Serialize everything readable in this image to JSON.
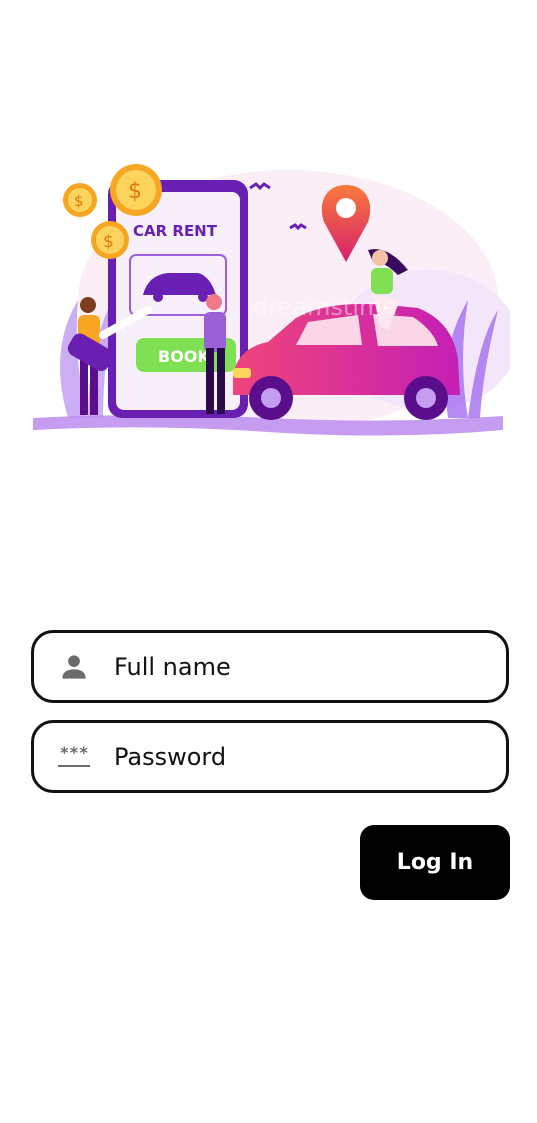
{
  "illustration": {
    "sign_text": "CAR RENT",
    "button_text": "BOOK",
    "coin_symbol": "$",
    "watermark": "dreamstime"
  },
  "form": {
    "name_placeholder": "Full name",
    "password_placeholder": "Password",
    "password_icon_text": "***",
    "login_label": "Log In"
  },
  "icons": {
    "name": "person-icon",
    "password": "password-dots-icon"
  },
  "colors": {
    "accent_purple": "#8e3fd6",
    "car_pink": "#f0447a",
    "book_green": "#7ee052",
    "coin_orange": "#f6a623",
    "button_bg": "#000000"
  }
}
